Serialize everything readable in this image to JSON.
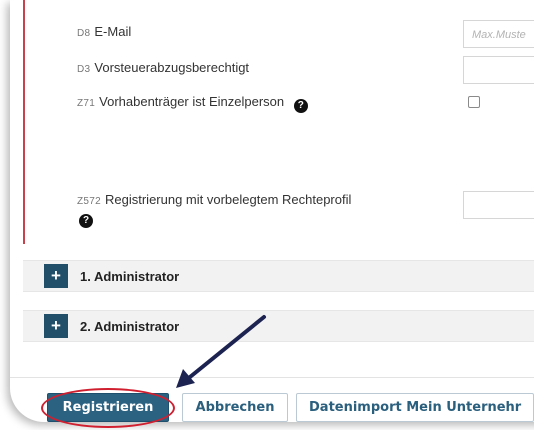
{
  "form": {
    "fields": [
      {
        "code": "D8",
        "label": "E-Mail",
        "placeholder": "Max.Muste"
      },
      {
        "code": "D3",
        "label": "Vorsteuerabzugsberechtigt"
      },
      {
        "code": "Z71",
        "label": "Vorhabenträger ist Einzelperson",
        "help_icon": "question-circle-icon",
        "checked": false
      },
      {
        "code": "Z572",
        "label": "Registrierung mit vorbelegtem Rechteprofil",
        "help_icon": "question-circle-icon"
      }
    ]
  },
  "sections": [
    {
      "toggle": "+",
      "title": "1. Administrator"
    },
    {
      "toggle": "+",
      "title": "2. Administrator"
    }
  ],
  "buttons": {
    "register": "Registrieren",
    "cancel": "Abbrechen",
    "import": "Datenimport Mein Unternehr"
  },
  "help_glyph": "?",
  "colors": {
    "primary": "#2c6281",
    "plus_button": "#214f6a",
    "required_marker": "#c9414a",
    "annotation_arrow": "#1d2350",
    "annotation_ellipse": "#d02030"
  }
}
